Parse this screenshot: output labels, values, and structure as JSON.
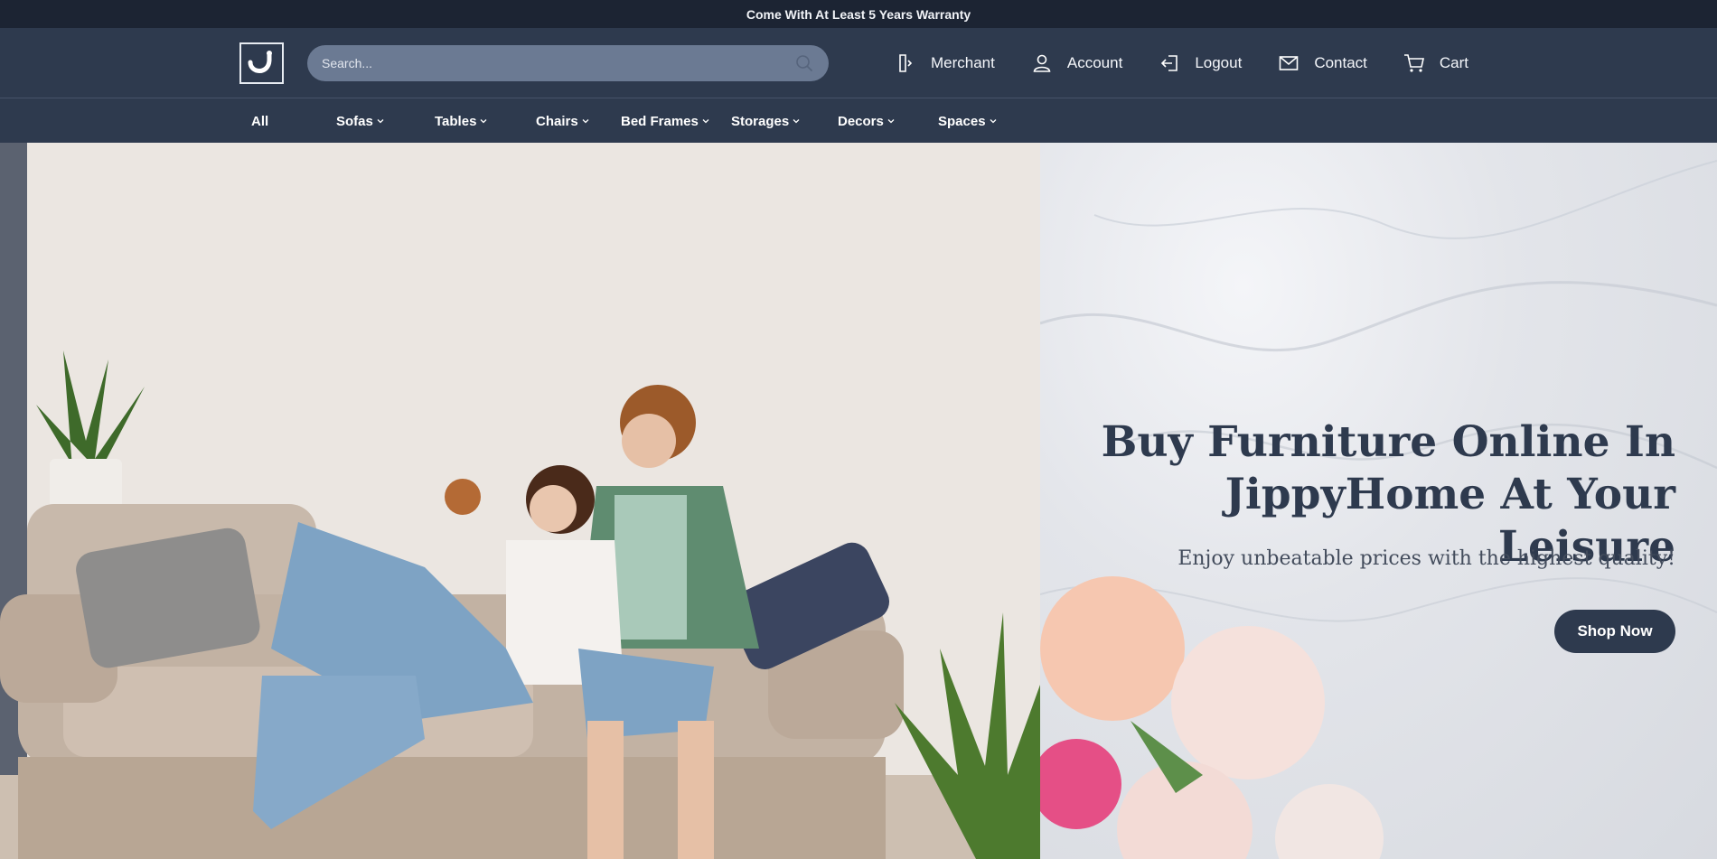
{
  "announcement": "Come With At Least 5 Years Warranty",
  "header": {
    "logo_icon": "jippyhome-logo",
    "search": {
      "placeholder": "Search..."
    },
    "links": [
      {
        "label": "Merchant",
        "icon": "merchant-icon"
      },
      {
        "label": "Account",
        "icon": "user-icon"
      },
      {
        "label": "Logout",
        "icon": "logout-icon"
      },
      {
        "label": "Contact",
        "icon": "mail-icon"
      },
      {
        "label": "Cart",
        "icon": "cart-icon"
      }
    ]
  },
  "categories": [
    {
      "label": "All",
      "has_dropdown": false
    },
    {
      "label": "Sofas",
      "has_dropdown": true
    },
    {
      "label": "Tables",
      "has_dropdown": true
    },
    {
      "label": "Chairs",
      "has_dropdown": true
    },
    {
      "label": "Bed Frames",
      "has_dropdown": true
    },
    {
      "label": "Storages",
      "has_dropdown": true
    },
    {
      "label": "Decors",
      "has_dropdown": true
    },
    {
      "label": "Spaces",
      "has_dropdown": true
    }
  ],
  "hero": {
    "title_line1": "Buy Furniture Online In",
    "title_line2": "JippyHome At Your Leisure",
    "subtitle": "Enjoy unbeatable prices with the highest quality!",
    "cta": "Shop Now"
  },
  "colors": {
    "navy": "#2e3a4e",
    "topbar": "#1c2433",
    "search_bg": "#6b7a93"
  }
}
